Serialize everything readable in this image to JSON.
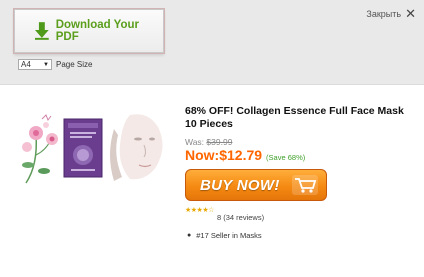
{
  "toolbar": {
    "download_label": "Download Your PDF",
    "close_label": "Закрыть",
    "page_size": {
      "selected": "A4",
      "label": "Page Size"
    }
  },
  "product": {
    "title": "68% OFF! Collagen Essence Full Face Mask 10 Pieces",
    "was_label": "Was: ",
    "was_price": "$39.99",
    "now_price": "Now:$12.79",
    "save_text": "(Save 68%)",
    "buy_label": "BUY NOW!",
    "stars": "★★★★☆",
    "rating": 4,
    "reviews": "8 (34 reviews)",
    "seller_rank": "#17 Seller in Masks"
  },
  "colors": {
    "download_green": "#5a9e1c",
    "price_orange": "#ff6600",
    "save_green": "#3fa02a",
    "buy_orange": "#f58a12"
  },
  "icons": [
    "download-arrow-icon",
    "close-icon",
    "dropdown-caret-icon",
    "cart-icon",
    "bullet-icon"
  ]
}
